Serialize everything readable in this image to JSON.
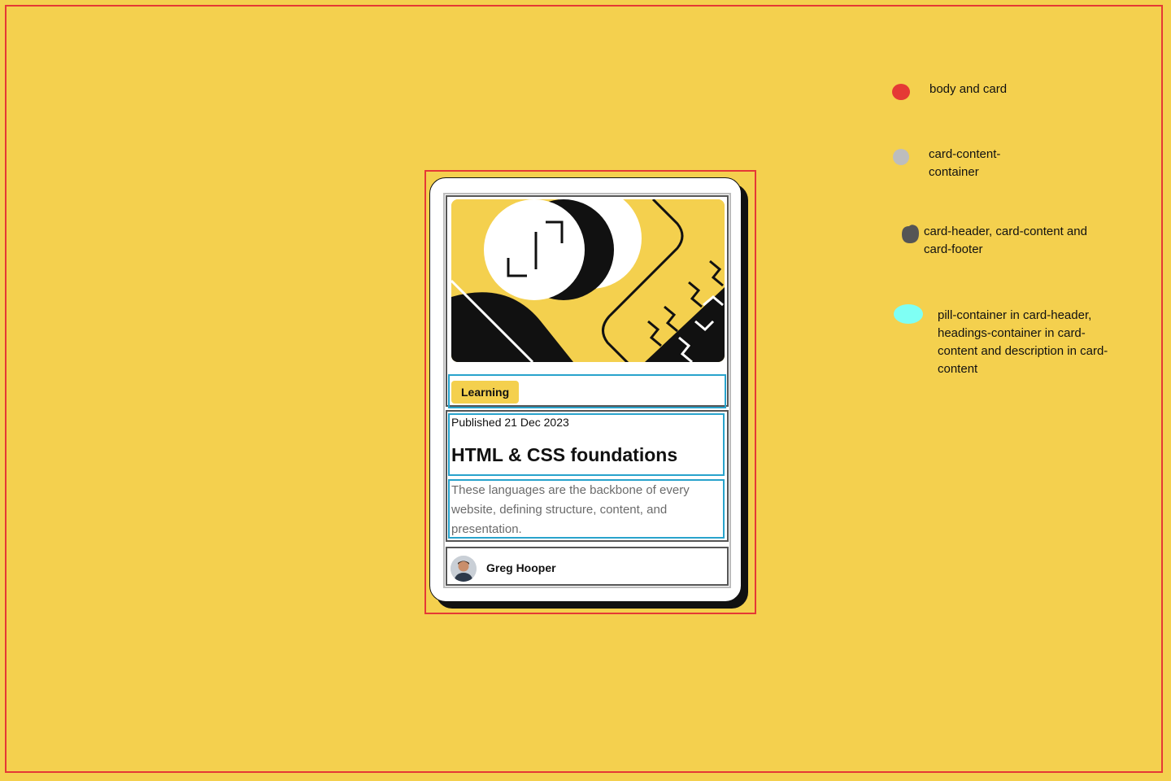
{
  "colors": {
    "background": "#F4D04E",
    "outline_body_card": "#E53935",
    "outline_content_container": "#BDBDBD",
    "outline_sections": "#555555",
    "outline_inner": "#29A3CC",
    "text_primary": "#111111",
    "text_muted": "#6B6B6B"
  },
  "card": {
    "illustration_icon": "abstract-illustration",
    "pill_label": "Learning",
    "published": "Published 21 Dec 2023",
    "title": "HTML & CSS foundations",
    "description": "These languages are the backbone of every website, defining structure, content, and presentation.",
    "author": {
      "name": "Greg Hooper",
      "avatar_icon": "user-avatar"
    }
  },
  "legend": [
    {
      "label": "body and card",
      "color": "#E53935"
    },
    {
      "label": "card-content-\ncontainer",
      "color": "#BDBDBD"
    },
    {
      "label": "card-header, card-content and\ncard-footer",
      "color": "#555555"
    },
    {
      "label": "pill-container in card-header,\nheadings-container in card-\ncontent and description in card-\ncontent",
      "color": "#7FFFF4"
    }
  ]
}
